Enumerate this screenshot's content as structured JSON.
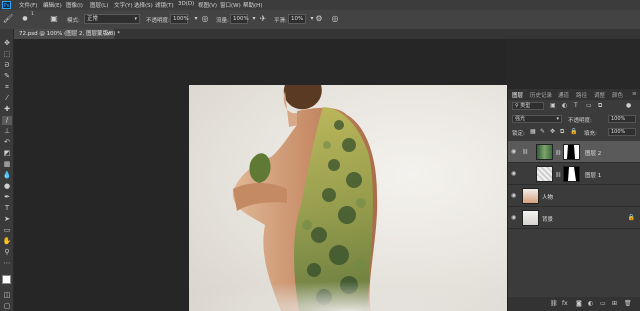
{
  "menu": [
    "文件(F)",
    "编辑(E)",
    "图像(I)",
    "图层(L)",
    "文字(Y)",
    "选择(S)",
    "滤镜(T)",
    "3D(D)",
    "视图(V)",
    "窗口(W)",
    "帮助(H)"
  ],
  "options": {
    "brush_size": "1",
    "mode_label": "模式:",
    "mode_value": "正常",
    "opacity_label": "不透明度:",
    "opacity_value": "100%",
    "flow_label": "流量:",
    "flow_value": "100%",
    "smooth_label": "平滑:",
    "smooth_value": "10%"
  },
  "document_tab": "72.psd @ 100% (图层 2, 图层蒙版/8) *",
  "panel": {
    "tabs": [
      "图层",
      "历史记录",
      "通道",
      "路径",
      "调整",
      "颜色"
    ],
    "filter_kind": "类型",
    "blend_mode": "强光",
    "opacity_label": "不透明度:",
    "opacity_value": "100%",
    "lock_label": "锁定:",
    "fill_label": "填充:",
    "fill_value": "100%",
    "layers": [
      {
        "name": "图层 2",
        "selected": true
      },
      {
        "name": "图层 1",
        "selected": false
      },
      {
        "name": "人物",
        "selected": false
      },
      {
        "name": "背景",
        "selected": false
      }
    ]
  },
  "colors": {
    "accent": "#31a8ff",
    "panel_bg": "#3b3b3b",
    "selected_row": "#5a5a5a"
  }
}
